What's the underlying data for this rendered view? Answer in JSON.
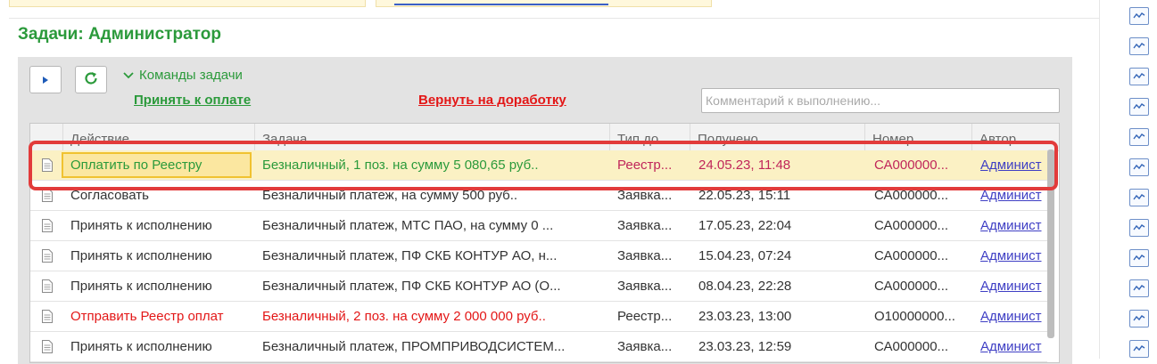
{
  "section": {
    "title": "Задачи: Администратор"
  },
  "toolbar": {
    "play_icon": "play-icon",
    "refresh_icon": "refresh-icon",
    "commands_label": "Команды задачи",
    "accept_label": "Принять к оплате",
    "return_label": "Вернуть на доработку",
    "comment_placeholder": "Комментарий к выполнению...",
    "comment_value": ""
  },
  "grid": {
    "columns": [
      "Действие",
      "Задача",
      "Тип до...",
      "Получено",
      "Номер",
      "Автор"
    ],
    "rows": [
      {
        "action": "Оплатить по Реестру",
        "task": "Безналичный, 1 поз. на сумму 5 080,65 руб..",
        "type": "Реестр...",
        "received": "24.05.23, 11:48",
        "number": "СА000000...",
        "author": "Админист",
        "style": "selected"
      },
      {
        "action": "Согласовать",
        "task": "Безналичный платеж,  на сумму 500 руб..",
        "type": "Заявка...",
        "received": "22.05.23, 15:11",
        "number": "СА000000...",
        "author": "Админист",
        "style": "normal"
      },
      {
        "action": "Принять к исполнению",
        "task": "Безналичный платеж, МТС ПАО,  на сумму 0 ...",
        "type": "Заявка...",
        "received": "17.05.23, 22:04",
        "number": "СА000000...",
        "author": "Админист",
        "style": "normal"
      },
      {
        "action": "Принять к исполнению",
        "task": "Безналичный платеж, ПФ СКБ КОНТУР АО,  н...",
        "type": "Заявка...",
        "received": "15.04.23, 07:24",
        "number": "СА000000...",
        "author": "Админист",
        "style": "normal"
      },
      {
        "action": "Принять к исполнению",
        "task": "Безналичный платеж, ПФ СКБ КОНТУР АО (О...",
        "type": "Заявка...",
        "received": "08.04.23, 22:28",
        "number": "СА000000...",
        "author": "Админист",
        "style": "normal"
      },
      {
        "action": "Отправить Реестр оплат",
        "task": "Безналичный, 2 поз. на сумму 2 000 000 руб..",
        "type": "Реестр...",
        "received": "23.03.23, 13:00",
        "number": "О10000000...",
        "author": "Админист",
        "style": "overdue"
      },
      {
        "action": "Принять к исполнению",
        "task": "Безналичный платеж, ПРОМПРИВОДСИСТЕМ...",
        "type": "Заявка...",
        "received": "23.03.23, 12:59",
        "number": "СА000000...",
        "author": "Админист",
        "style": "normal"
      }
    ]
  },
  "colors": {
    "accent_green": "#2b9a3b",
    "accent_red": "#e31717",
    "selected_row": "#fbf1c4",
    "selected_text": "#c0265a",
    "highlight_frame": "#e23b3b"
  },
  "side_icons": [
    "chart-icon",
    "chart-icon",
    "chart-icon",
    "chart-icon",
    "chart-icon",
    "chart-icon",
    "chart-icon",
    "chart-icon",
    "chart-icon",
    "chart-icon",
    "chart-icon",
    "chart-icon"
  ]
}
